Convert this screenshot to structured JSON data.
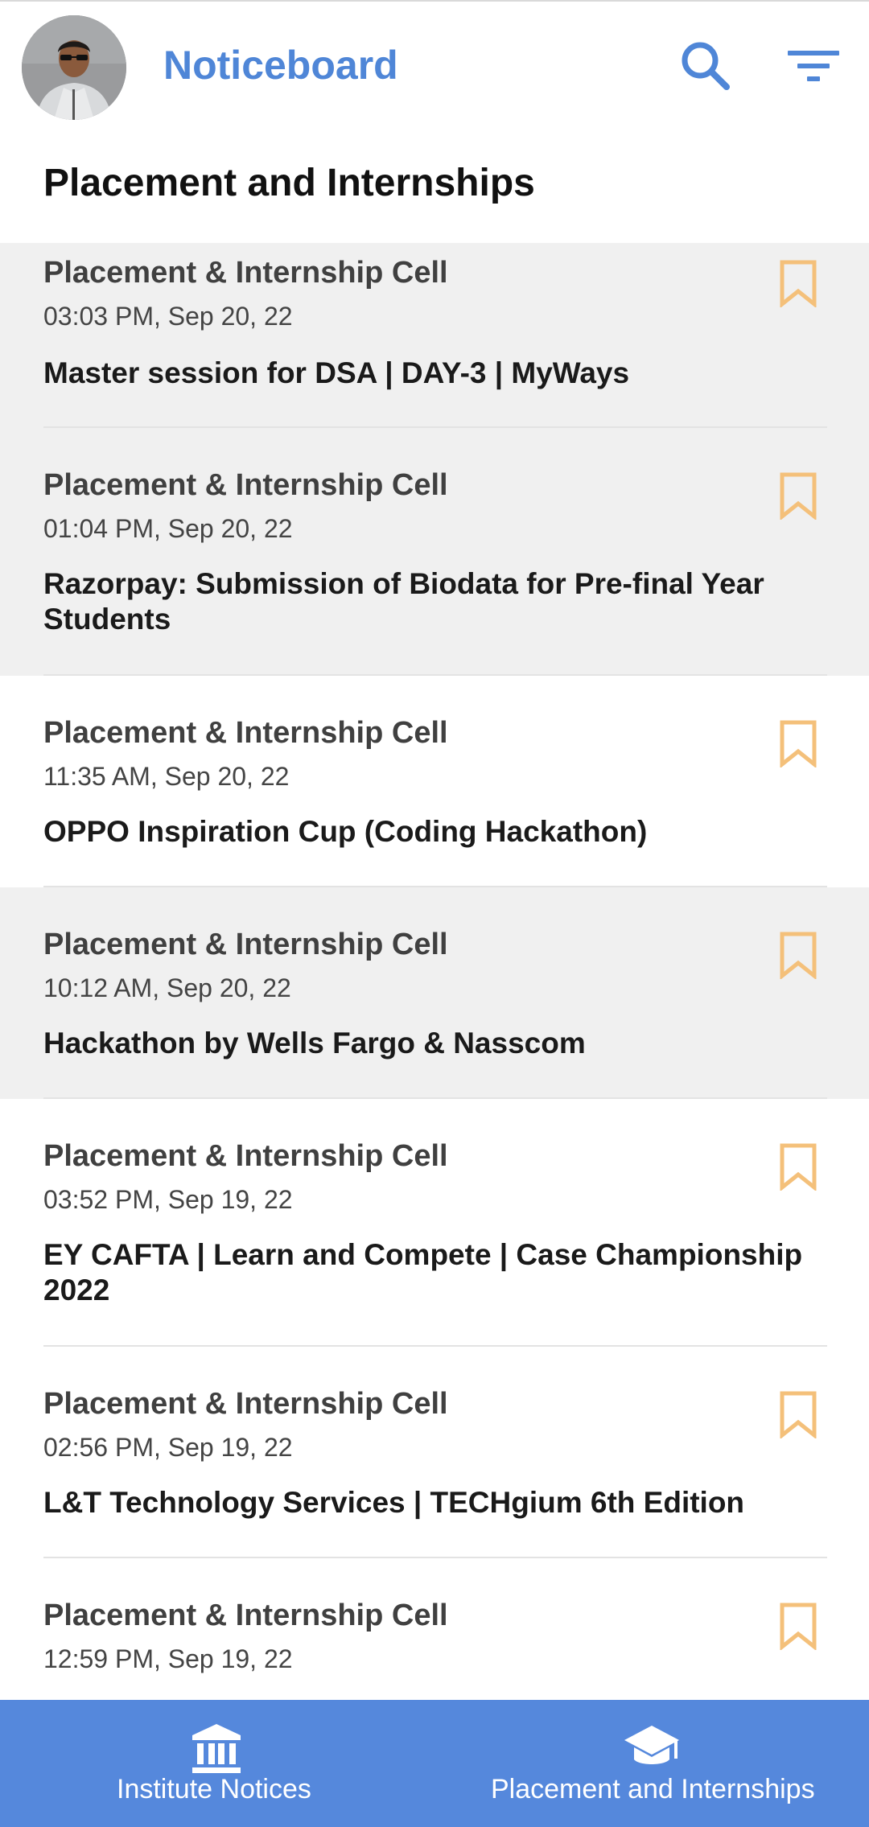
{
  "app_bar": {
    "title": "Noticeboard",
    "avatar_icon": "profile-avatar",
    "search_icon": "search-icon",
    "filter_icon": "filter-icon",
    "accent_color": "#4f86d7"
  },
  "section": {
    "title": "Placement and Internships"
  },
  "notices": [
    {
      "source": "Placement & Internship Cell",
      "time": "03:03 PM, Sep 20, 22",
      "title": "Master session for DSA | DAY-3 | MyWays",
      "unread": true
    },
    {
      "source": "Placement & Internship Cell",
      "time": "01:04 PM, Sep 20, 22",
      "title": "Razorpay: Submission of Biodata for Pre-final Year Students",
      "unread": true
    },
    {
      "source": "Placement & Internship Cell",
      "time": "11:35 AM, Sep 20, 22",
      "title": "OPPO Inspiration Cup (Coding Hackathon)",
      "unread": false
    },
    {
      "source": "Placement & Internship Cell",
      "time": "10:12 AM, Sep 20, 22",
      "title": "Hackathon by Wells Fargo & Nasscom",
      "unread": true
    },
    {
      "source": "Placement & Internship Cell",
      "time": "03:52 PM, Sep 19, 22",
      "title": "EY CAFTA | Learn and Compete | Case Championship 2022",
      "unread": false
    },
    {
      "source": "Placement & Internship Cell",
      "time": "02:56 PM, Sep 19, 22",
      "title": "L&T Technology Services | TECHgium 6th Edition",
      "unread": false
    },
    {
      "source": "Placement & Internship Cell",
      "time": "12:59 PM, Sep 19, 22",
      "title": "",
      "unread": false
    }
  ],
  "bookmark_icon": "bookmark-outline-icon",
  "bookmark_color": "#f4c07a",
  "bottom_nav": {
    "color": "#5588dc",
    "items": [
      {
        "label": "Institute Notices",
        "icon": "institute-building-icon"
      },
      {
        "label": "Placement and Internships",
        "icon": "graduation-cap-icon"
      }
    ]
  }
}
